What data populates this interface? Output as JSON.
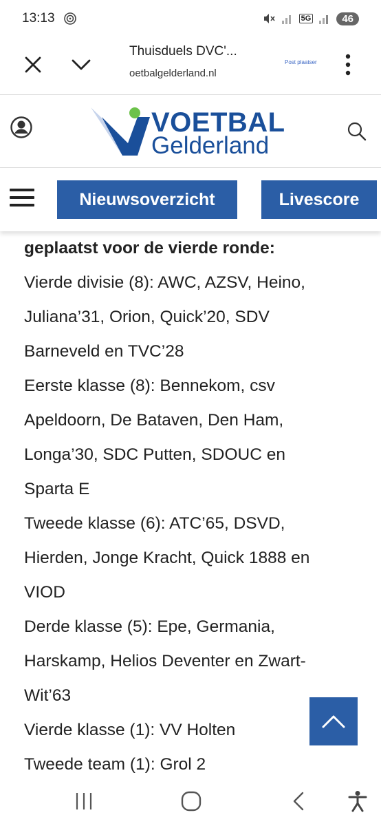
{
  "status": {
    "time": "13:13",
    "network": "5G",
    "battery": "46"
  },
  "browser": {
    "page_title": "Thuisduels DVC'...",
    "url": "oetbalgelderland.nl",
    "ad_label": "Post plaatser"
  },
  "site": {
    "logo_line1": "VOETBAL",
    "logo_line2": "Gelderland",
    "colors": {
      "brand": "#2b5ea6",
      "accent": "#6cc24a"
    }
  },
  "nav": {
    "news_label": "Nieuwsoverzicht",
    "live_label": "Livescore"
  },
  "article": {
    "heading": "geplaatst voor de vierde ronde:",
    "lines": [
      "Vierde divisie (8): AWC, AZSV, Heino,",
      "Juliana’31, Orion, Quick’20, SDV",
      "Barneveld en TVC’28",
      "Eerste klasse (8): Bennekom, csv",
      "Apeldoorn, De Bataven, Den Ham,",
      "Longa’30, SDC Putten, SDOUC en",
      "Sparta E",
      "Tweede klasse (6): ATC’65, DSVD,",
      "Hierden, Jonge Kracht, Quick 1888 en",
      "VIOD",
      "Derde klasse (5): Epe, Germania,",
      "Harskamp, Helios Deventer en Zwart-",
      "Wit’63",
      "Vierde klasse (1): VV Holten",
      "Tweede team (1): Grol 2"
    ]
  },
  "icons": {
    "close": "close-icon",
    "chevron": "chevron-down-icon",
    "menu": "more-vert-icon",
    "user": "user-icon",
    "search": "search-icon",
    "scroll": "chevron-up-icon"
  }
}
